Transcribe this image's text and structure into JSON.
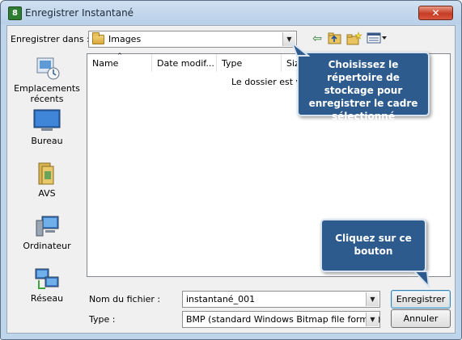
{
  "window": {
    "title": "Enregistrer Instantané",
    "app_icon": "avs-app-icon",
    "close_symbol": "✕"
  },
  "location": {
    "label": "Enregistrer dans :",
    "value": "Images"
  },
  "toolbar": {
    "icons": [
      "back-arrow-icon",
      "up-folder-icon",
      "new-folder-icon",
      "view-menu-icon"
    ]
  },
  "sidebar": {
    "items": [
      {
        "label": "Emplacements récents",
        "icon": "recent-places-icon"
      },
      {
        "label": "Bureau",
        "icon": "desktop-icon"
      },
      {
        "label": "AVS",
        "icon": "avs-folder-icon"
      },
      {
        "label": "Ordinateur",
        "icon": "computer-icon"
      },
      {
        "label": "Réseau",
        "icon": "network-icon"
      }
    ]
  },
  "file_list": {
    "columns": [
      "Name",
      "Date modif...",
      "Type",
      "Siz"
    ],
    "empty_message": "Le dossier est vi"
  },
  "filename": {
    "label": "Nom du fichier :",
    "value": "instantané_001"
  },
  "filetype": {
    "label": "Type :",
    "value": "BMP (standard Windows Bitmap file format)"
  },
  "buttons": {
    "save": "Enregistrer",
    "cancel": "Annuler"
  },
  "callouts": {
    "folder_hint": "Choisissez le répertoire de stockage pour enregistrer le cadre sélectionné",
    "save_hint": "Cliquez sur ce bouton"
  },
  "colors": {
    "callout_bg": "#2e5b8e",
    "window_frame": "#bfd5ea",
    "close_button": "#c63c25"
  }
}
